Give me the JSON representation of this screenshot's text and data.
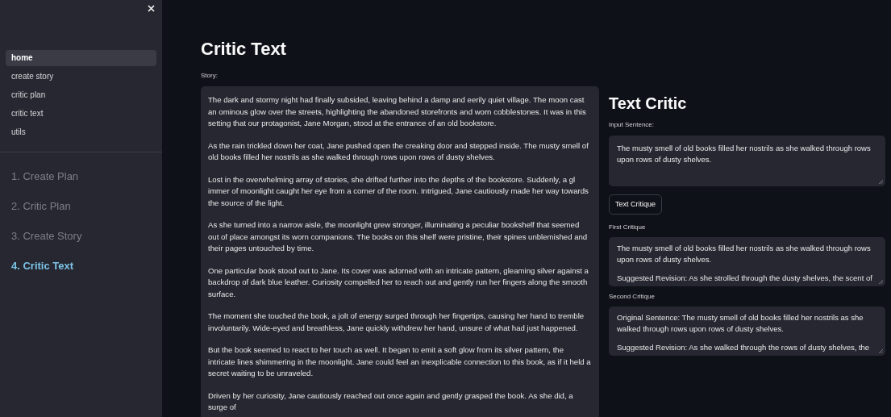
{
  "sidebar": {
    "nav_items": [
      {
        "label": "home",
        "selected": true
      },
      {
        "label": "create story",
        "selected": false
      },
      {
        "label": "critic plan",
        "selected": false
      },
      {
        "label": "critic text",
        "selected": false
      },
      {
        "label": "utils",
        "selected": false
      }
    ],
    "steps": [
      {
        "label": "1. Create Plan",
        "selected": false
      },
      {
        "label": "2. Critic Plan",
        "selected": false
      },
      {
        "label": "3. Create Story",
        "selected": false
      },
      {
        "label": "4. Critic Text",
        "selected": true
      }
    ]
  },
  "main": {
    "title": "Critic Text",
    "story": {
      "label": "Story:",
      "paragraphs": [
        "The dark and stormy night had finally subsided, leaving behind a damp and eerily quiet village. The moon cast an ominous glow over the streets, highlighting the abandoned storefronts and worn cobblestones. It was in this setting that our protagonist, Jane Morgan, stood at the entrance of an old bookstore.",
        "As the rain trickled down her coat, Jane pushed open the creaking door and stepped inside. The musty smell of old books filled her nostrils as she walked through rows upon rows of dusty shelves.",
        "Lost in the overwhelming array of stories, she drifted further into the depths of the bookstore. Suddenly, a gl immer of moonlight caught her eye from a corner of the room. Intrigued, Jane cautiously made her way towards the source of the light.",
        "As she turned into a narrow aisle, the moonlight grew stronger, illuminating a peculiar bookshelf that seemed out of place amongst its worn companions. The books on this shelf were pristine, their spines unblemished and their pages untouched by time.",
        "One particular book stood out to Jane. Its cover was adorned with an intricate pattern, gleaming silver against a backdrop of dark blue leather. Curiosity compelled her to reach out and gently run her fingers along the smooth surface.",
        "The moment she touched the book, a jolt of energy surged through her fingertips, causing her hand to tremble involuntarily. Wide-eyed and breathless, Jane quickly withdrew her hand, unsure of what had just happened.",
        "But the book seemed to react to her touch as well. It began to emit a soft glow from its silver pattern, the intricate lines shimmering in the moonlight. Jane could feel an inexplicable connection to this book, as if it held a secret waiting to be unraveled.",
        "Driven by her curiosity, Jane cautiously reached out once again and gently grasped the book. As she did, a surge of"
      ]
    }
  },
  "critic": {
    "title": "Text Critic",
    "input": {
      "label": "Input Sentence:",
      "value": "The musty smell of old books filled her nostrils as she walked through rows upon rows of dusty shelves."
    },
    "button": "Text Critique",
    "critiques": [
      {
        "label": "First Critique",
        "paragraphs": [
          "The musty smell of old books filled her nostrils as she walked through rows upon rows of dusty shelves.",
          "Suggested Revision: As she strolled through the dusty shelves, the scent of"
        ]
      },
      {
        "label": "Second Critique",
        "paragraphs": [
          "Original Sentence: The musty smell of old books filled her nostrils as she walked through rows upon rows of dusty shelves.",
          "Suggested Revision: As she walked through the rows of dusty shelves, the"
        ]
      }
    ]
  }
}
